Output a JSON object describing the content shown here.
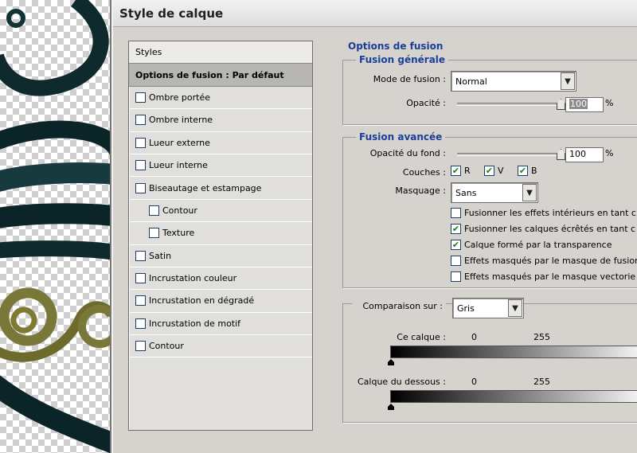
{
  "dialog": {
    "title": "Style de calque"
  },
  "styles_panel": {
    "header": "Styles",
    "active": "Options de fusion : Par défaut",
    "items": [
      {
        "label": "Ombre portée",
        "checked": false
      },
      {
        "label": "Ombre interne",
        "checked": false
      },
      {
        "label": "Lueur externe",
        "checked": false
      },
      {
        "label": "Lueur interne",
        "checked": false
      },
      {
        "label": "Biseautage et estampage",
        "checked": false
      },
      {
        "label": "Contour",
        "checked": false
      },
      {
        "label": "Texture",
        "checked": false
      },
      {
        "label": "Satin",
        "checked": false
      },
      {
        "label": "Incrustation couleur",
        "checked": false
      },
      {
        "label": "Incrustation en dégradé",
        "checked": false
      },
      {
        "label": "Incrustation de motif",
        "checked": false
      },
      {
        "label": "Contour",
        "checked": false
      }
    ]
  },
  "options": {
    "title": "Options de fusion",
    "general": {
      "title": "Fusion générale",
      "mode_label": "Mode de fusion :",
      "mode_value": "Normal",
      "opacity_label": "Opacité :",
      "opacity_value": "100",
      "opacity_unit": "%",
      "opacity_level": 1.0
    },
    "advanced": {
      "title": "Fusion avancée",
      "fill_opacity_label": "Opacité du fond :",
      "fill_opacity_value": "100",
      "fill_opacity_unit": "%",
      "fill_opacity_level": 1.0,
      "channels_label": "Couches :",
      "channels": [
        {
          "label": "R",
          "checked": true
        },
        {
          "label": "V",
          "checked": true
        },
        {
          "label": "B",
          "checked": true
        }
      ],
      "knockout_label": "Masquage :",
      "knockout_value": "Sans",
      "checks": [
        {
          "label": "Fusionner les effets intérieurs en tant c",
          "checked": false
        },
        {
          "label": "Fusionner les calques écrêtés en tant c",
          "checked": true
        },
        {
          "label": "Calque formé par la transparence",
          "checked": true
        },
        {
          "label": "Effets masqués par le masque de fusion",
          "checked": false
        },
        {
          "label": "Effets masqués par le masque vectorie",
          "checked": false
        }
      ]
    },
    "blend_if": {
      "label": "Comparaison sur :",
      "value": "Gris",
      "this_layer_label": "Ce calque :",
      "underlying_label": "Calque du dessous :",
      "min": "0",
      "max": "255"
    }
  }
}
